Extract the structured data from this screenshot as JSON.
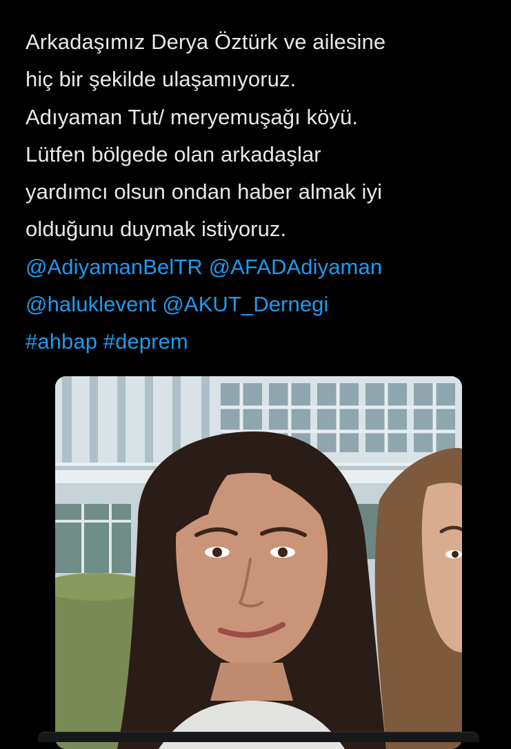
{
  "tweet": {
    "lines": {
      "l1": "Arkadaşımız Derya Öztürk ve ailesine",
      "l2": "hiç bir şekilde ulaşamıyoruz.",
      "l3": "Adıyaman Tut/ meryemuşağı köyü.",
      "l4": "Lütfen bölgede olan arkadaşlar",
      "l5": "yardımcı olsun ondan haber almak iyi",
      "l6": "olduğunu duymak istiyoruz."
    },
    "mentions": [
      "@AdiyamanBelTR",
      "@AFADAdiyaman",
      "@haluklevent",
      "@AKUT_Dernegi"
    ],
    "hashtags": [
      "#ahbap",
      "#deprem"
    ]
  },
  "colors": {
    "background": "#000000",
    "text": "#e7e9ea",
    "link": "#1d9bf0"
  }
}
